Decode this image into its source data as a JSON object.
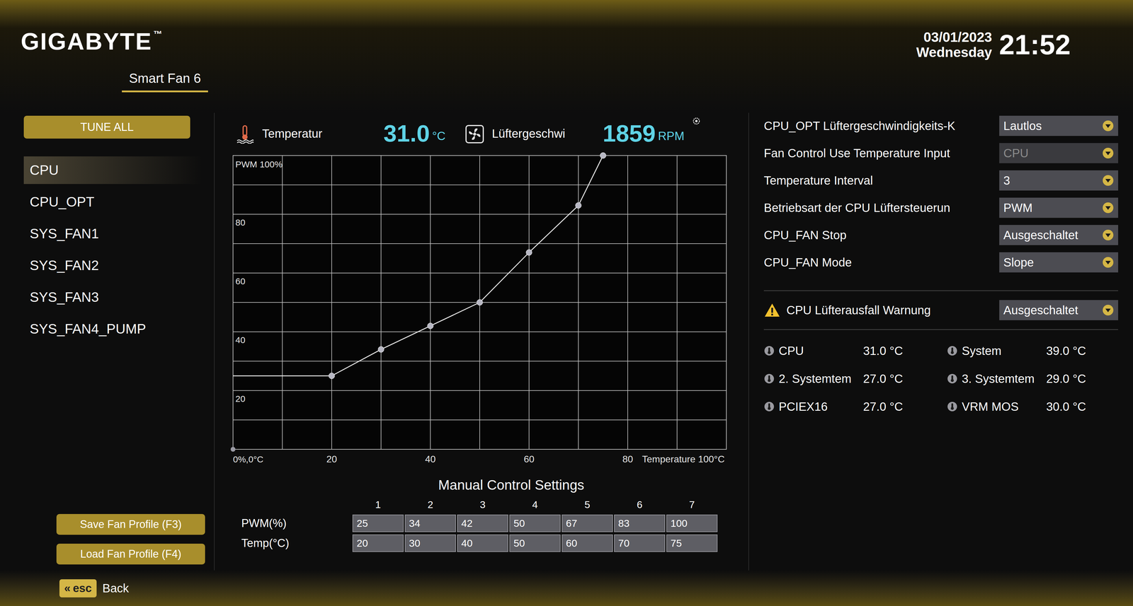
{
  "header": {
    "logo": "GIGABYTE",
    "trademark": "™",
    "date": "03/01/2023",
    "weekday": "Wednesday",
    "time": "21:52"
  },
  "tabs": [
    {
      "label": "Smart Fan 6",
      "selected": true
    }
  ],
  "sidebar": {
    "tune_all": "TUNE ALL",
    "items": [
      {
        "label": "CPU",
        "selected": true
      },
      {
        "label": "CPU_OPT",
        "selected": false
      },
      {
        "label": "SYS_FAN1",
        "selected": false
      },
      {
        "label": "SYS_FAN2",
        "selected": false
      },
      {
        "label": "SYS_FAN3",
        "selected": false
      },
      {
        "label": "SYS_FAN4_PUMP",
        "selected": false
      }
    ]
  },
  "readout": {
    "temperature_label": "Temperatur",
    "temperature": "31.0",
    "temperature_unit": "°C",
    "fan_label": "Lüftergeschwi",
    "fan_speed": "1859",
    "fan_unit": "RPM"
  },
  "chart": {
    "y_ticks": [
      "PWM 100%",
      "80",
      "60",
      "40",
      "20"
    ],
    "origin": "0%,0°C",
    "x_ticks": [
      "20",
      "40",
      "60",
      "80",
      "Temperature 100°C"
    ],
    "series": [
      {
        "temp": [
          20,
          30,
          40,
          50,
          60,
          70,
          75
        ],
        "pwm": [
          25,
          34,
          42,
          50,
          67,
          83,
          100
        ]
      }
    ]
  },
  "manual": {
    "title": "Manual Control Settings",
    "columns": [
      "1",
      "2",
      "3",
      "4",
      "5",
      "6",
      "7"
    ],
    "rows": [
      {
        "label": "PWM(%)",
        "values": [
          "25",
          "34",
          "42",
          "50",
          "67",
          "83",
          "100"
        ]
      },
      {
        "label": "Temp(°C)",
        "values": [
          "20",
          "30",
          "40",
          "50",
          "60",
          "70",
          "75"
        ]
      }
    ]
  },
  "settings": [
    {
      "label": "CPU_OPT Lüftergeschwindigkeits-K",
      "value": "Lautlos",
      "disabled": false
    },
    {
      "label": "Fan Control Use Temperature Input",
      "value": "CPU",
      "disabled": true
    },
    {
      "label": "Temperature Interval",
      "value": "3",
      "disabled": false
    },
    {
      "label": "Betriebsart der CPU Lüftersteuerun",
      "value": "PWM",
      "disabled": false
    },
    {
      "label": "CPU_FAN Stop",
      "value": "Ausgeschaltet",
      "disabled": false
    },
    {
      "label": "CPU_FAN Mode",
      "value": "Slope",
      "disabled": false
    }
  ],
  "warning": {
    "label": "CPU Lüfterausfall Warnung",
    "value": "Ausgeschaltet"
  },
  "sensors": [
    {
      "label": "CPU",
      "value": "31.0 °C"
    },
    {
      "label": "System",
      "value": "39.0 °C"
    },
    {
      "label": "2. Systemtem",
      "value": "27.0 °C"
    },
    {
      "label": "3. Systemtem",
      "value": "29.0 °C"
    },
    {
      "label": "PCIEX16",
      "value": "27.0 °C"
    },
    {
      "label": "VRM MOS",
      "value": "30.0 °C"
    }
  ],
  "buttons": [
    "Save Fan Profile (F3)",
    "Load Fan Profile (F4)"
  ],
  "footer": {
    "key_icon": "«",
    "key": "esc",
    "label": "Back"
  }
}
